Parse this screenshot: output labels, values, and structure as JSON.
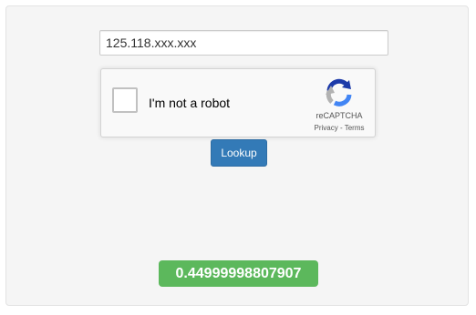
{
  "ip_lookup": {
    "value": "125.118.xxx.xxx",
    "placeholder": ""
  },
  "captcha": {
    "label": "I'm not a robot",
    "brand": "reCAPTCHA",
    "privacy_link": "Privacy",
    "separator": " - ",
    "terms_link": "Terms",
    "checked": false,
    "icon": "recaptcha-logo-icon"
  },
  "lookup_button": {
    "label": "Lookup"
  },
  "result": {
    "score": "0.44999998807907"
  },
  "colors": {
    "panel_bg": "#f5f5f5",
    "button_primary": "#337ab7",
    "result_success": "#5cb85c",
    "recaptcha_blue_dark": "#1c3aa9",
    "recaptcha_blue": "#4285f4",
    "recaptcha_grey": "#b2b2b2"
  }
}
